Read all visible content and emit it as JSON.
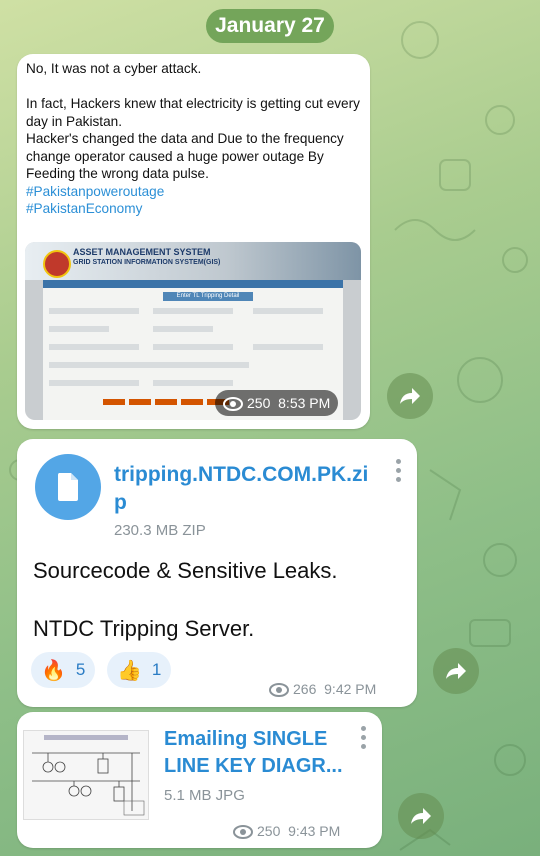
{
  "date_separator": "January 27",
  "messages": [
    {
      "text": "No, It was not a cyber attack.\n\nIn fact, Hackers knew that electricity is getting cut every day in Pakistan.\nHacker's changed the data and Due to the frequency change operator caused a huge power outage By Feeding the wrong data pulse.\n",
      "hashtags": [
        "#Pakistanpoweroutage",
        "#PakistanEconomy"
      ],
      "image": {
        "title_line1": "ASSET MANAGEMENT SYSTEM",
        "title_line2": "GRID STATION INFORMATION SYSTEM(GIS)",
        "form_title": "Enter TL Tripping Detail"
      },
      "views": "250",
      "time": "8:53 PM"
    },
    {
      "file_name": "tripping.NTDC.COM.PK.zip",
      "file_size": "230.3 MB ZIP",
      "text": "Sourcecode & Sensitive Leaks.\n\nNTDC Tripping Server.",
      "reactions": [
        {
          "emoji": "🔥",
          "count": "5"
        },
        {
          "emoji": "👍",
          "count": "1"
        }
      ],
      "views": "266",
      "time": "9:42 PM"
    },
    {
      "file_name": "Emailing SINGLE LINE KEY DIAGR...",
      "file_size": "5.1 MB JPG",
      "views": "250",
      "time": "9:43 PM"
    }
  ],
  "colors": {
    "date_pill": "#74a55a",
    "link": "#2a8bd3",
    "file_icon": "#53a6e6",
    "reaction_bg": "#e7f1fb"
  },
  "icons": [
    "eye-icon",
    "forward-icon",
    "file-icon",
    "more-icon"
  ]
}
